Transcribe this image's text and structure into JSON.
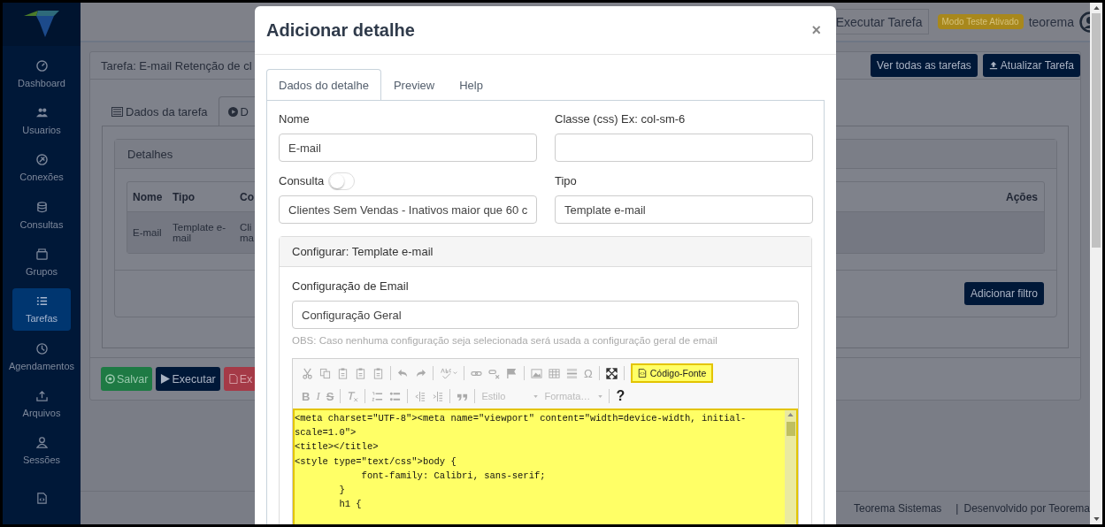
{
  "sidebar": {
    "items": [
      {
        "label": "Dashboard",
        "selected": false
      },
      {
        "label": "Usuarios",
        "selected": false
      },
      {
        "label": "Conexões",
        "selected": false
      },
      {
        "label": "Consultas",
        "selected": false
      },
      {
        "label": "Grupos",
        "selected": false
      },
      {
        "label": "Tarefas",
        "selected": true
      },
      {
        "label": "Agendamentos",
        "selected": false
      },
      {
        "label": "Arquivos",
        "selected": false
      },
      {
        "label": "Sessões",
        "selected": false
      },
      {
        "selected": false
      }
    ]
  },
  "topbar": {
    "run_button": "Executar Tarefa",
    "badge": "Modo Teste Ativado",
    "user": "teorema"
  },
  "task_card": {
    "title": "Tarefa: E-mail Retenção de cl",
    "buttons": [
      "Ver todas as tarefas",
      "Atualizar Tarefa"
    ],
    "tabs": [
      {
        "label": "Dados da tarefa",
        "selected": false
      },
      {
        "label": "D",
        "selected": true
      }
    ],
    "details_panel": {
      "title": "Detalhes",
      "columns": [
        "Nome",
        "Tipo",
        "Co",
        "Ações"
      ],
      "rows": [
        [
          "E-mail",
          "Template e-mail",
          "Cli ma"
        ]
      ],
      "add_filter_button": "Adicionar filtro"
    },
    "action_buttons": [
      {
        "label": "Salvar",
        "kind": "success"
      },
      {
        "label": "Executar",
        "kind": "primary"
      },
      {
        "label": "Ex",
        "kind": "danger"
      }
    ]
  },
  "footer": {
    "company": "Teorema Sistemas",
    "separator": "|",
    "developed_by": "Desenvolvido por Teorema"
  },
  "modal": {
    "title": "Adicionar detalhe",
    "close": "×",
    "tabs": [
      {
        "label": "Dados do detalhe",
        "selected": true
      },
      {
        "label": "Preview",
        "selected": false
      },
      {
        "label": "Help",
        "selected": false
      }
    ],
    "fields": {
      "name": {
        "label": "Nome",
        "value": "E-mail"
      },
      "css_class": {
        "label": "Classe (css) Ex: col-sm-6"
      },
      "query": {
        "label": "Consulta",
        "on": false,
        "value": "Clientes Sem Vendas - Inativos maior que 60 c"
      },
      "type": {
        "label": "Tipo",
        "value": "Template e-mail"
      }
    },
    "config_panel": {
      "title": "Configurar: Template e-mail",
      "email_config": {
        "label": "Configuração de Email",
        "value": "Configuração Geral"
      },
      "note": "OBS: Caso nenhuma configuração seja selecionada será usada a configuração geral de email",
      "editor": {
        "special_char": "Ω",
        "bold": "B",
        "italic": "I",
        "strike": "S",
        "help": "?",
        "source_button": {
          "label": "Código-Fonte",
          "highlighted": true
        },
        "style_dropdown": "Estilo",
        "format_dropdown": "Formata…",
        "code_highlighted": true,
        "code_lines": [
          "<meta charset=\"UTF-8\"><meta name=\"viewport\" content=\"width=device-width, initial-",
          "scale=1.0\">",
          "<title></title>",
          "<style type=\"text/css\">body {",
          "            font-family: Calibri, sans-serif;",
          "        }",
          "        h1 {"
        ]
      }
    }
  }
}
